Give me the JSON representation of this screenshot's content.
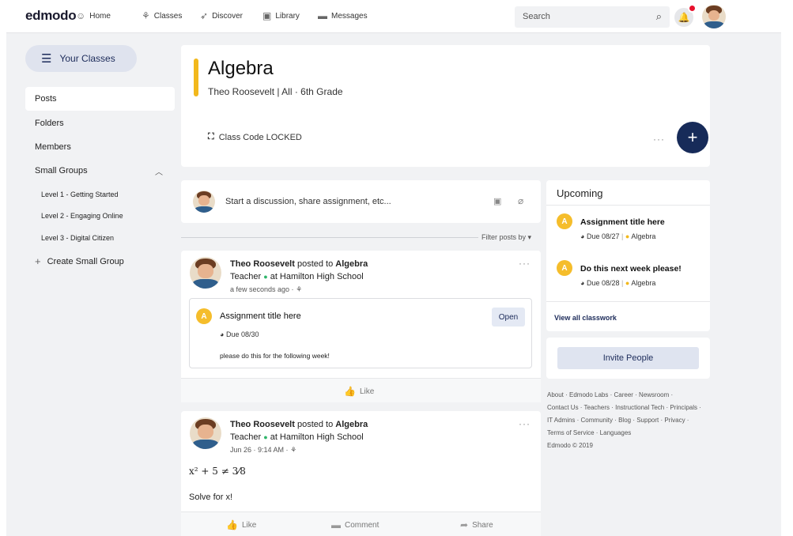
{
  "nav": {
    "logo": "edmodo",
    "items": [
      {
        "label": "Home",
        "icon": "home-icon"
      },
      {
        "label": "Classes",
        "icon": "classes-icon"
      },
      {
        "label": "Discover",
        "icon": "discover-icon"
      },
      {
        "label": "Library",
        "icon": "library-icon"
      },
      {
        "label": "Messages",
        "icon": "messages-icon"
      }
    ],
    "search_placeholder": "Search"
  },
  "sidebar": {
    "your_classes": "Your Classes",
    "items": [
      "Posts",
      "Folders",
      "Members",
      "Small Groups"
    ],
    "groups": [
      "Level 1 - Getting Started",
      "Level 2 - Engaging Online",
      "Level 3 - Digital Citizen"
    ],
    "create_group": "Create Small Group"
  },
  "class": {
    "title": "Algebra",
    "subtitle": "Theo Roosevelt | All  · 6th Grade",
    "code": "Class Code LOCKED",
    "dots": "···",
    "add": "+"
  },
  "composer": {
    "placeholder": "Start a discussion, share assignment, etc..."
  },
  "filter": "Filter posts by ▾",
  "posts": [
    {
      "author": "Theo Roosevelt",
      "posted_to": "posted to",
      "class": "Algebra",
      "role": "Teacher",
      "school": "at Hamilton High School",
      "time": "a few seconds ago ·",
      "assignment": {
        "title": "Assignment title here",
        "open": "Open",
        "due": "Due 08/30",
        "desc": "please do this for the following week!"
      },
      "like": "Like"
    },
    {
      "author": "Theo Roosevelt",
      "posted_to": "posted to",
      "class": "Algebra",
      "role": "Teacher",
      "school": "at Hamilton High School",
      "time": "Jun 26 · 9:14 AM ·",
      "math": "x² + 5 ≠ 3⁄8",
      "body": "Solve for x!",
      "like": "Like",
      "comment": "Comment",
      "share": "Share"
    }
  ],
  "upcoming": {
    "title": "Upcoming",
    "items": [
      {
        "title": "Assignment title here",
        "due": "Due 08/27",
        "class": "Algebra"
      },
      {
        "title": "Do this next week please!",
        "due": "Due 08/28",
        "class": "Algebra"
      }
    ],
    "view_all": "View all classwork"
  },
  "invite": "Invite People",
  "footer": {
    "line1": "About · Edmodo Labs · Career · Newsroom ·",
    "line2": "Contact Us · Teachers · Instructional Tech · Principals ·",
    "line3": "IT Admins · Community · Blog · Support · Privacy ·",
    "line4": "Terms of Service  · Languages",
    "line5": "Edmodo © 2019"
  }
}
